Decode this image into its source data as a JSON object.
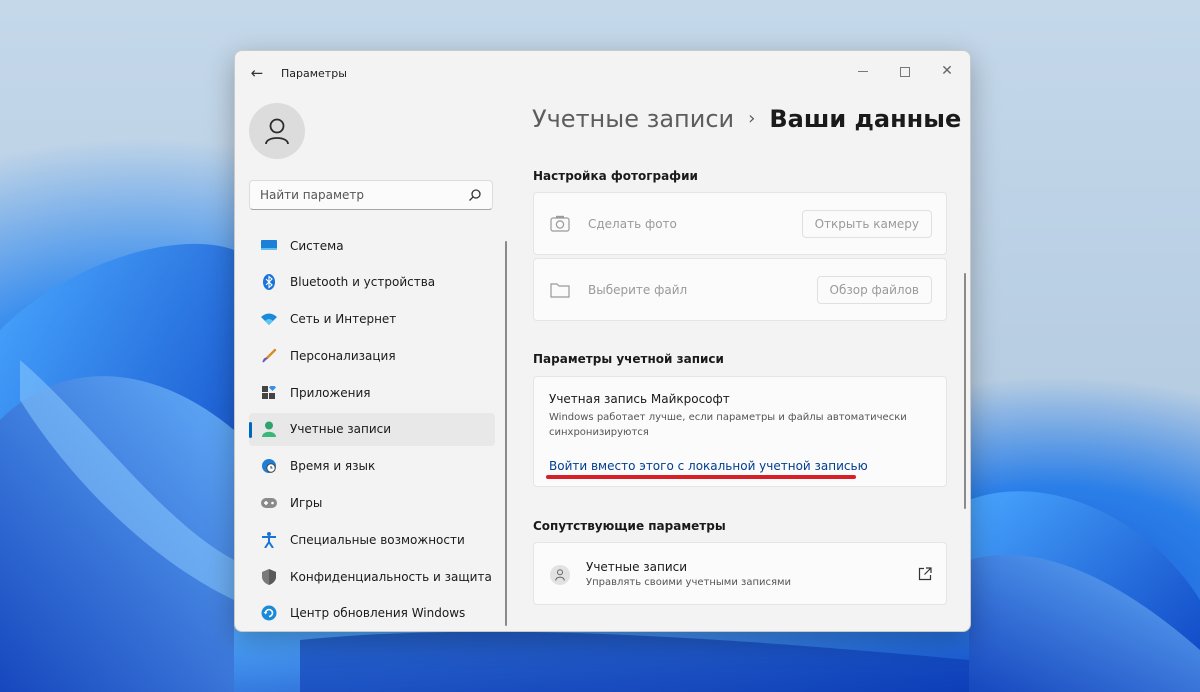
{
  "window": {
    "app_title": "Параметры"
  },
  "sidebar": {
    "search_placeholder": "Найти параметр",
    "items": [
      {
        "label": "Система",
        "icon": "system-icon",
        "active": false
      },
      {
        "label": "Bluetooth и устройства",
        "icon": "bluetooth-icon",
        "active": false
      },
      {
        "label": "Сеть и Интернет",
        "icon": "wifi-icon",
        "active": false
      },
      {
        "label": "Персонализация",
        "icon": "brush-icon",
        "active": false
      },
      {
        "label": "Приложения",
        "icon": "apps-icon",
        "active": false
      },
      {
        "label": "Учетные записи",
        "icon": "accounts-icon",
        "active": true
      },
      {
        "label": "Время и язык",
        "icon": "globe-clock-icon",
        "active": false
      },
      {
        "label": "Игры",
        "icon": "gamepad-icon",
        "active": false
      },
      {
        "label": "Специальные возможности",
        "icon": "accessibility-icon",
        "active": false
      },
      {
        "label": "Конфиденциальность и защита",
        "icon": "shield-icon",
        "active": false
      },
      {
        "label": "Центр обновления Windows",
        "icon": "update-icon",
        "active": false
      }
    ]
  },
  "main": {
    "breadcrumb": {
      "parent": "Учетные записи",
      "separator": "›",
      "current": "Ваши данные"
    },
    "photo_section": {
      "title": "Настройка фотографии",
      "take_photo_label": "Сделать фото",
      "open_camera_button": "Открыть камеру",
      "choose_file_label": "Выберите файл",
      "browse_files_button": "Обзор файлов"
    },
    "account_section": {
      "title": "Параметры учетной записи",
      "ms_account_title": "Учетная запись Майкрософт",
      "ms_account_desc": "Windows работает лучше, если параметры и файлы автоматически синхронизируются",
      "local_account_link": "Войти вместо этого с локальной учетной записью"
    },
    "related_section": {
      "title": "Сопутствующие параметры",
      "accounts_title": "Учетные записи",
      "accounts_subtitle": "Управлять своими учетными записями"
    }
  },
  "colors": {
    "accent": "#0067c0",
    "link": "#003e92",
    "highlight_underline": "#d61f26"
  }
}
